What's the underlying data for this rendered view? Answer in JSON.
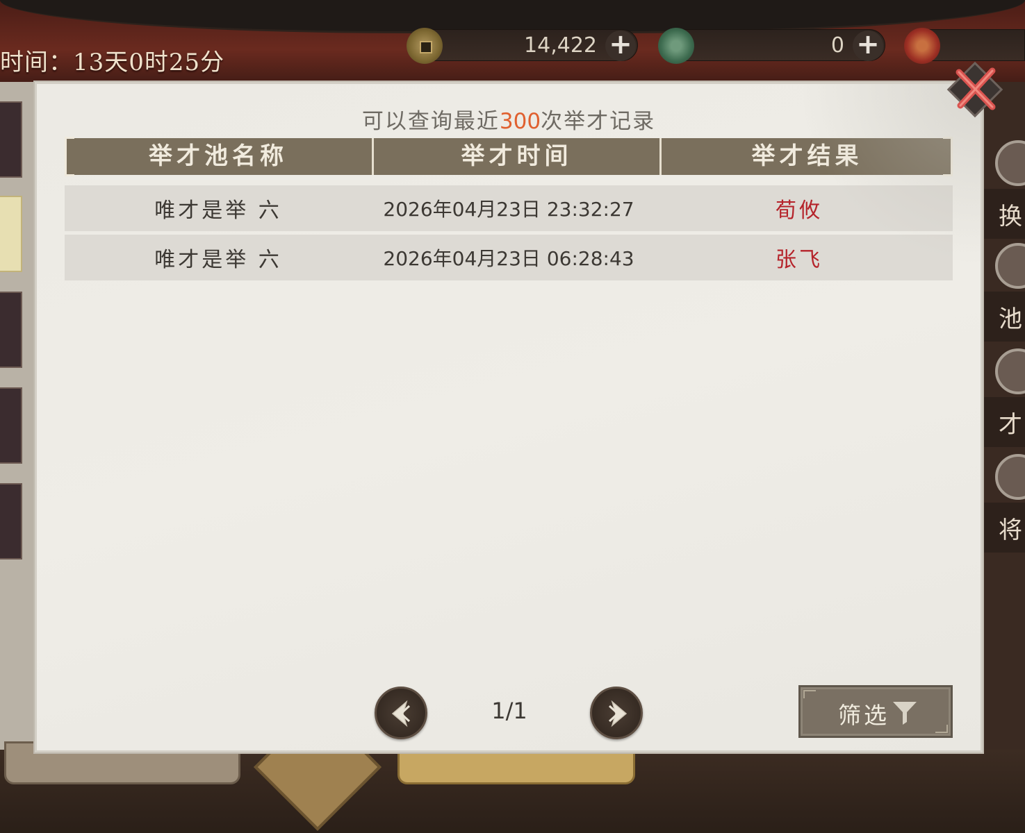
{
  "background": {
    "countdown_text": "时间：13天0时25分",
    "currencies": [
      {
        "icon": "copper-coin-icon",
        "amount": "14,422"
      },
      {
        "icon": "jade-token-icon",
        "amount": "0"
      },
      {
        "icon": "seal-token-icon",
        "amount": ""
      }
    ],
    "side_menu": [
      "换",
      "池",
      "才",
      "将"
    ]
  },
  "dialog": {
    "header_prefix": "可以查询最近",
    "header_highlight": "300",
    "header_suffix": "次举才记录",
    "columns": [
      "举才池名称",
      "举才时间",
      "举才结果"
    ],
    "rows": [
      {
        "pool": "唯才是举 六",
        "time": "2026年04月23日 23:32:27",
        "result": "荀攸"
      },
      {
        "pool": "唯才是举 六",
        "time": "2026年04月23日 06:28:43",
        "result": "张飞"
      }
    ],
    "page_indicator": "1/1",
    "filter_label": "筛选"
  },
  "colors": {
    "highlight_number": "#e0602f",
    "result_text": "#b5232a",
    "header_bar": "#7a6f5c",
    "row_background": "#dddad4",
    "close_x": "#d9534f"
  }
}
